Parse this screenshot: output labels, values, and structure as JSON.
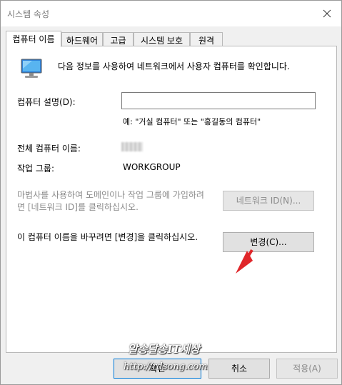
{
  "window": {
    "title": "시스템 속성"
  },
  "tabs": [
    {
      "label": "컴퓨터 이름"
    },
    {
      "label": "하드웨어"
    },
    {
      "label": "고급"
    },
    {
      "label": "시스템 보호"
    },
    {
      "label": "원격"
    }
  ],
  "panel": {
    "info_text": "다음 정보를 사용하여 네트워크에서 사용자 컴퓨터를 확인합니다.",
    "description_label": "컴퓨터 설명(D):",
    "description_value": "",
    "example_text": "예: \"거실 컴퓨터\" 또는 \"홍길동의 컴퓨터\"",
    "full_name_label": "전체 컴퓨터 이름:",
    "workgroup_label": "작업 그룹:",
    "workgroup_value": "WORKGROUP",
    "wizard_text": "마법사를 사용하여 도메인이나 작업 그룹에 가입하려면 [네트워크 ID]를 클릭하십시오.",
    "network_id_button": "네트워크 ID(N)...",
    "rename_text": "이 컴퓨터 이름을 바꾸려면 [변경]을 클릭하십시오.",
    "change_button": "변경(C)..."
  },
  "footer": {
    "ok_button": "확인",
    "cancel_button": "취소",
    "apply_button": "적용(A)"
  },
  "watermark": {
    "line1": "알송달송IT세상",
    "line2": "http://rdsong.com"
  },
  "icons": {
    "close": "close-icon",
    "computer": "computer-monitor-icon",
    "annotation": "red-arrow-icon"
  },
  "colors": {
    "arrow": "#e0262a",
    "panel_bg": "#ffffff",
    "window_bg": "#f0f0f0"
  }
}
